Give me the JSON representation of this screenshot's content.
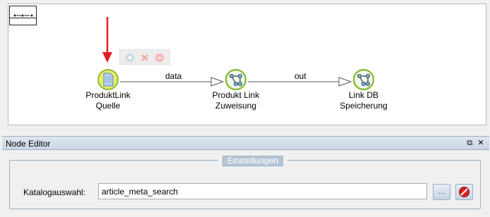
{
  "canvas": {
    "nodes": [
      {
        "label": "ProduktLink\nQuelle",
        "icon": "document-icon"
      },
      {
        "label": "Produkt Link\nZuweisung",
        "icon": "graph-node-icon"
      },
      {
        "label": "Link DB\nSpeicherung",
        "icon": "graph-node-icon"
      }
    ],
    "edges": [
      {
        "from": "ProduktLink Quelle",
        "to": "Produkt Link Zuweisung",
        "label": "data"
      },
      {
        "from": "Produkt Link Zuweisung",
        "to": "Link DB Speicherung",
        "label": "out"
      }
    ],
    "annotation_arrow_color": "#e02020"
  },
  "node_editor": {
    "title": "Node Editor",
    "restore_glyph": "⧉",
    "close_glyph": "✕"
  },
  "settings": {
    "legend": "Einstellungen",
    "catalog_label": "Katalogauswahl:",
    "catalog_value": "article_meta_search",
    "browse_label": "...",
    "colors": {
      "panel_border": "#9aafc6",
      "legend_bg": "#b7c6d6"
    }
  }
}
